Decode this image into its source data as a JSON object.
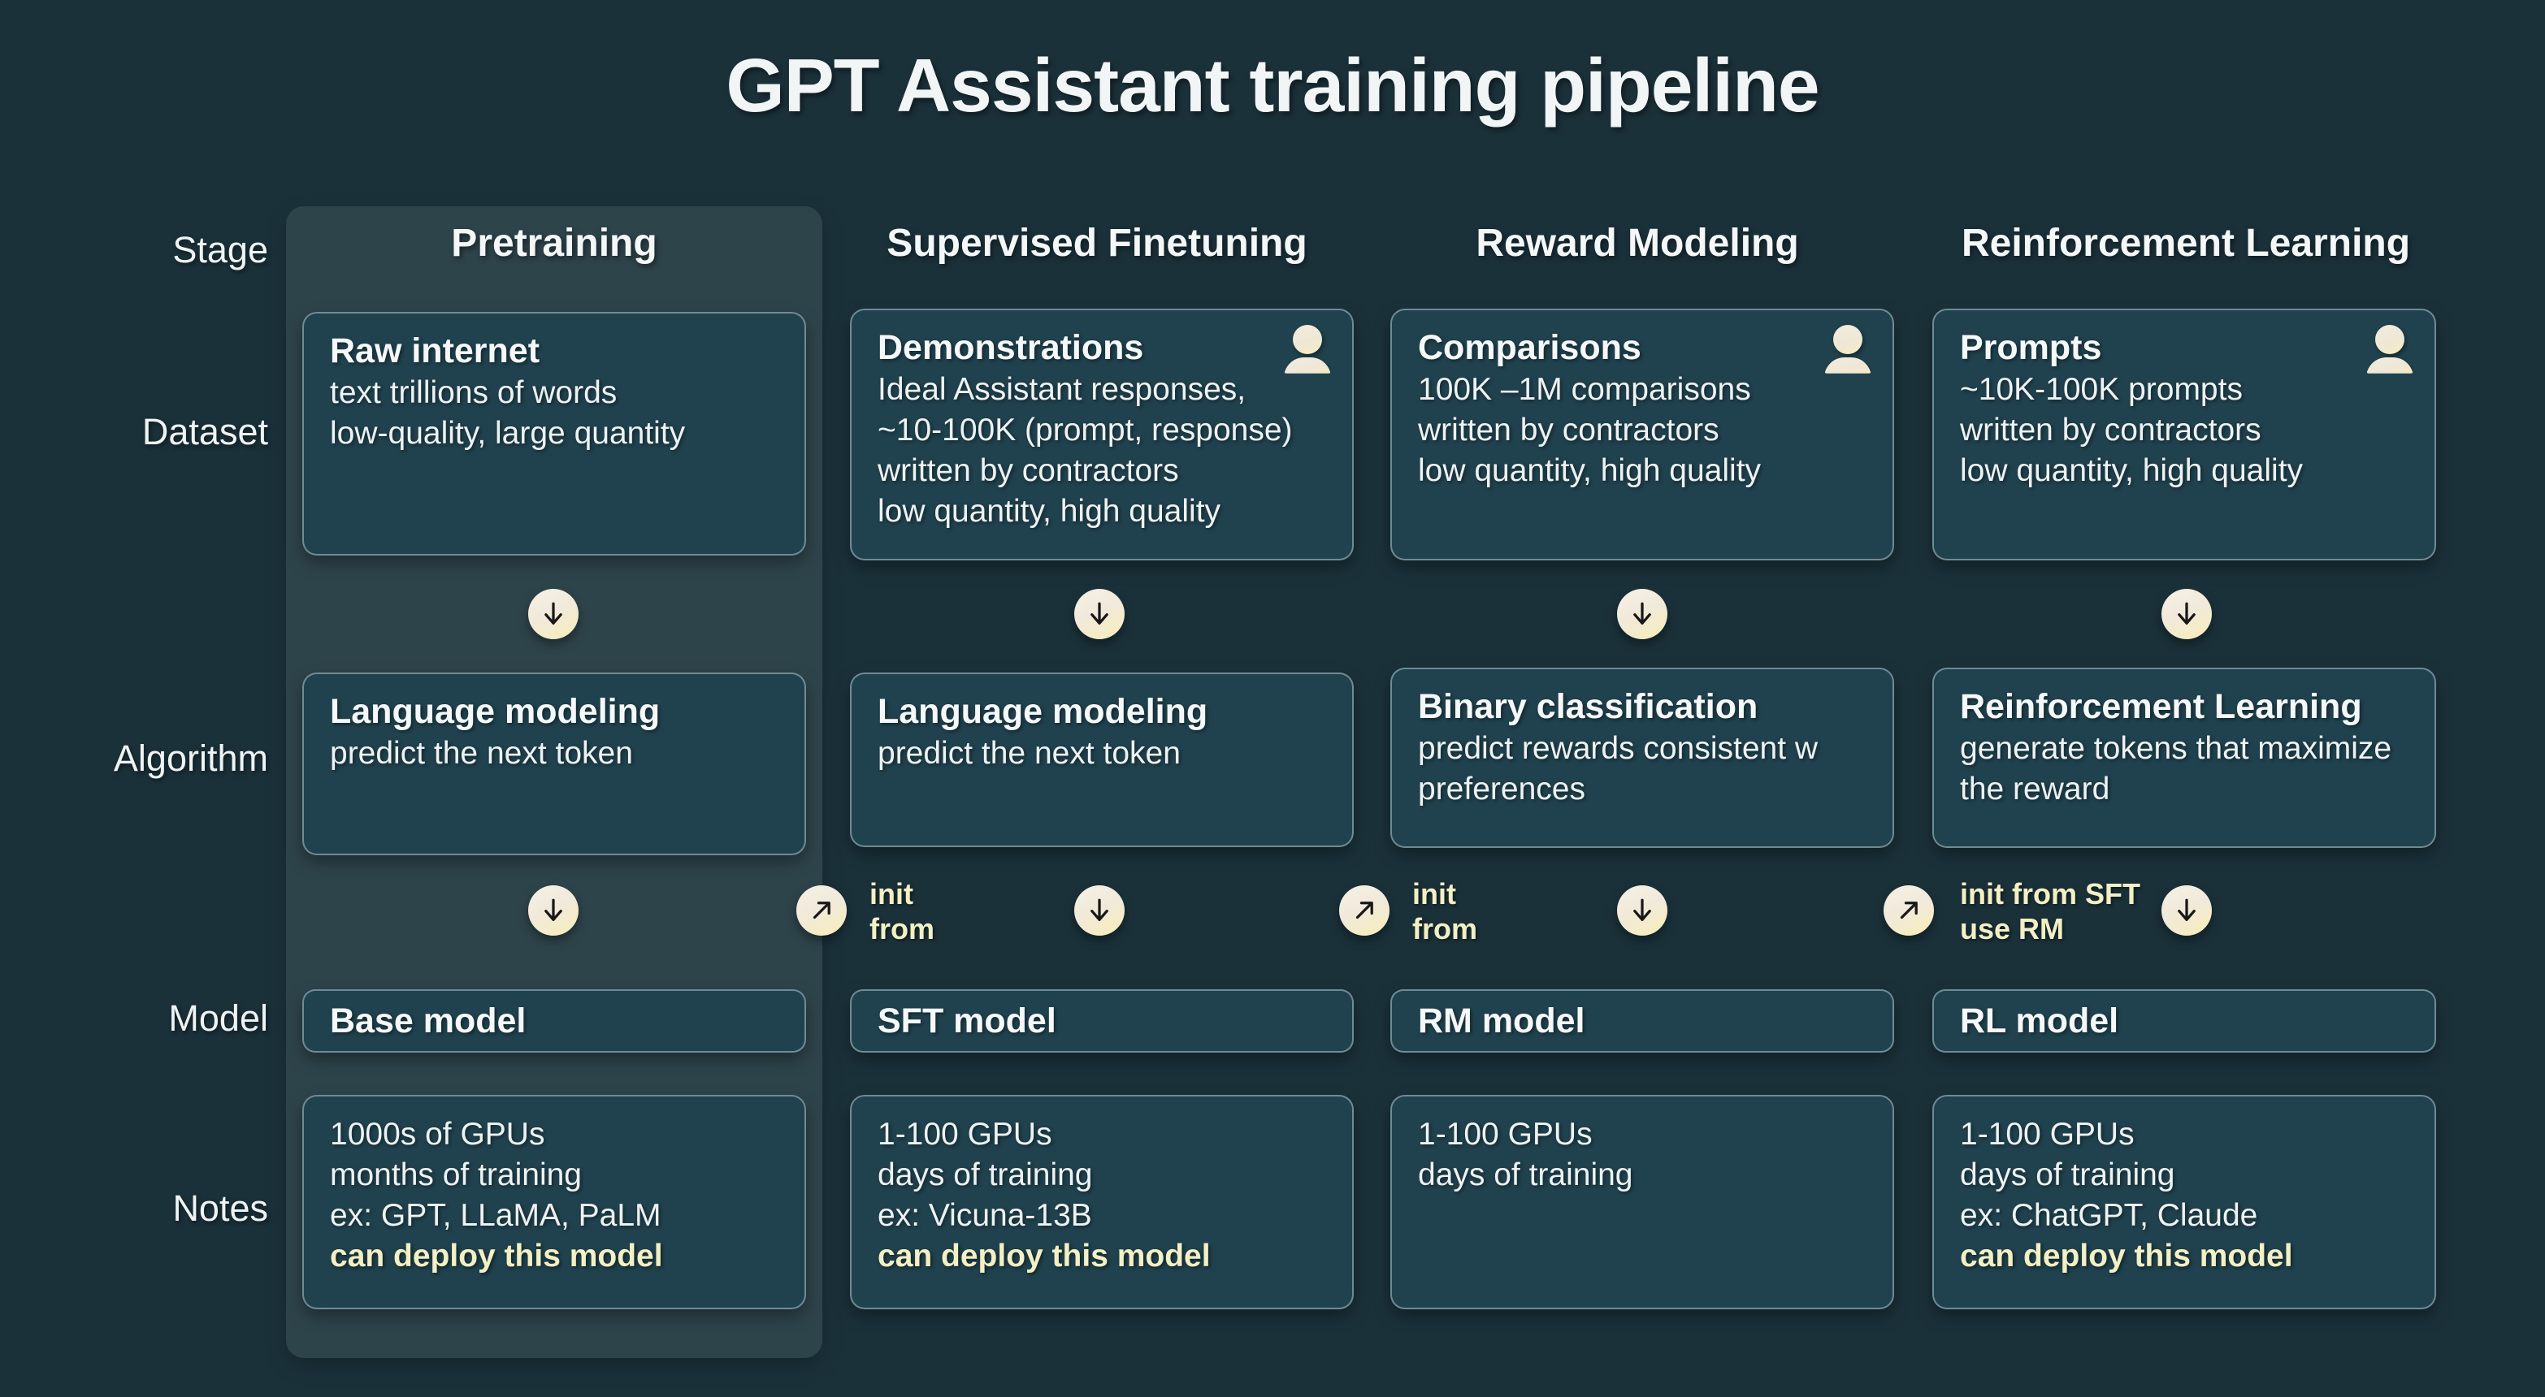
{
  "title": "GPT Assistant training pipeline",
  "row_labels": {
    "stage": "Stage",
    "dataset": "Dataset",
    "algorithm": "Algorithm",
    "model": "Model",
    "notes": "Notes"
  },
  "stages": [
    {
      "name": "Pretraining",
      "highlighted": true
    },
    {
      "name": "Supervised Finetuning",
      "highlighted": false
    },
    {
      "name": "Reward Modeling",
      "highlighted": false
    },
    {
      "name": "Reinforcement Learning",
      "highlighted": false
    }
  ],
  "dataset": [
    {
      "title": "Raw internet",
      "body": "text trillions of words\nlow-quality, large quantity",
      "has_person_icon": false
    },
    {
      "title": "Demonstrations",
      "body": "Ideal Assistant responses,\n~10-100K (prompt, response)\nwritten by contractors\nlow quantity, high quality",
      "has_person_icon": true
    },
    {
      "title": "Comparisons",
      "body": "100K –1M comparisons\nwritten by contractors\nlow quantity, high quality",
      "has_person_icon": true
    },
    {
      "title": "Prompts",
      "body": "~10K-100K prompts\nwritten by contractors\nlow quantity, high quality",
      "has_person_icon": true
    }
  ],
  "algorithm": [
    {
      "title": "Language modeling",
      "body": "predict the next token"
    },
    {
      "title": "Language modeling",
      "body": "predict the next token"
    },
    {
      "title": "Binary classification",
      "body": "predict rewards consistent w\npreferences"
    },
    {
      "title": "Reinforcement Learning",
      "body": "generate tokens that maximize\nthe reward"
    }
  ],
  "model": [
    {
      "name": "Base model"
    },
    {
      "name": "SFT model"
    },
    {
      "name": "RM model"
    },
    {
      "name": "RL model"
    }
  ],
  "notes": [
    {
      "lines": "1000s of GPUs\nmonths of training\nex: GPT, LLaMA, PaLM",
      "highlight": "can deploy this model"
    },
    {
      "lines": "1-100 GPUs\ndays of training\nex: Vicuna-13B",
      "highlight": "can deploy this model"
    },
    {
      "lines": "1-100 GPUs\ndays of training",
      "highlight": ""
    },
    {
      "lines": "1-100 GPUs\ndays of training\nex: ChatGPT, Claude",
      "highlight": "can deploy this model"
    }
  ],
  "connectors": {
    "down_arrow_icon": "arrow-down-icon",
    "diagonal_arrow_icon": "arrow-up-right-icon",
    "init_labels": [
      {
        "text": "init\nfrom"
      },
      {
        "text": "init\nfrom"
      },
      {
        "text": "init from SFT\nuse RM"
      }
    ]
  },
  "colors": {
    "background": "#1b313a",
    "card_fill": "#20424e",
    "card_border": "#b0c8ce",
    "text": "#f2f5f6",
    "accent_yellow": "#f2f0c4",
    "badge_fill": "#f4eddd",
    "highlight_panel": "rgba(214,232,228,0.10)"
  }
}
